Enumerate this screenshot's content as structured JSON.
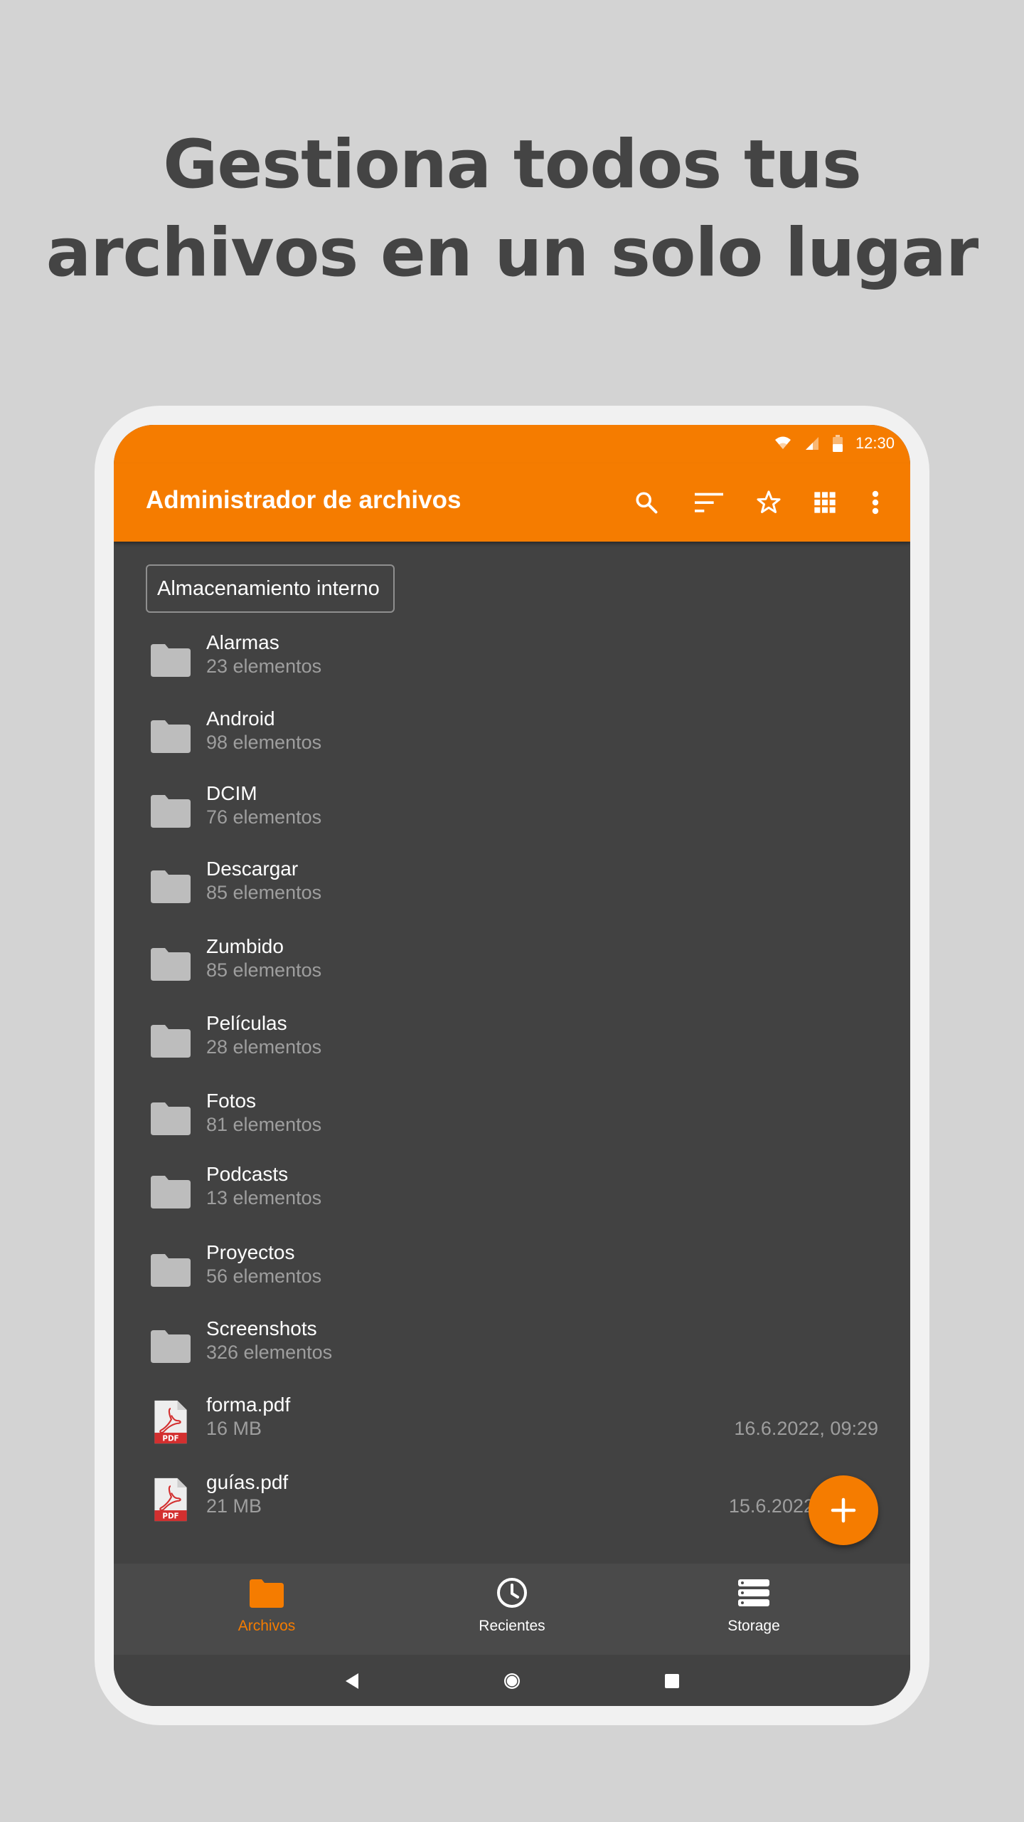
{
  "promo": {
    "line1": "Gestiona todos tus",
    "line2": "archivos en un solo lugar"
  },
  "statusbar": {
    "time": "12:30",
    "icons": [
      "wifi-icon",
      "signal-icon",
      "battery-icon"
    ]
  },
  "toolbar": {
    "title": "Administrador de archivos",
    "actions": [
      "search-icon",
      "sort-icon",
      "star-icon",
      "grid-view-icon",
      "more-options-icon"
    ]
  },
  "storage": {
    "label": "Almacenamiento interno"
  },
  "items": [
    {
      "name": "Alarmas",
      "sub": "23 elementos",
      "type": "folder"
    },
    {
      "name": "Android",
      "sub": "98 elementos",
      "type": "folder"
    },
    {
      "name": "DCIM",
      "sub": "76 elementos",
      "type": "folder"
    },
    {
      "name": "Descargar",
      "sub": "85 elementos",
      "type": "folder"
    },
    {
      "name": "Zumbido",
      "sub": "85 elementos",
      "type": "folder"
    },
    {
      "name": "Películas",
      "sub": "28 elementos",
      "type": "folder"
    },
    {
      "name": "Fotos",
      "sub": "81 elementos",
      "type": "folder"
    },
    {
      "name": "Podcasts",
      "sub": "13 elementos",
      "type": "folder"
    },
    {
      "name": "Proyectos",
      "sub": "56 elementos",
      "type": "folder"
    },
    {
      "name": "Screenshots",
      "sub": "326 elementos",
      "type": "folder"
    },
    {
      "name": "forma.pdf",
      "sub": "16 MB",
      "type": "pdf",
      "date": "16.6.2022, 09:29",
      "badge": "PDF"
    },
    {
      "name": "guías.pdf",
      "sub": "21 MB",
      "type": "pdf",
      "date": "15.6.2022",
      "badge": "PDF"
    }
  ],
  "bottom_nav": {
    "archivos": "Archivos",
    "recientes": "Recientes",
    "storage": "Storage"
  },
  "colors": {
    "accent": "#f57c00",
    "list_bg": "#424242",
    "folder": "#bdbdbd",
    "secondary_text": "#9e9e9e",
    "pdf_red": "#d32f2f"
  }
}
